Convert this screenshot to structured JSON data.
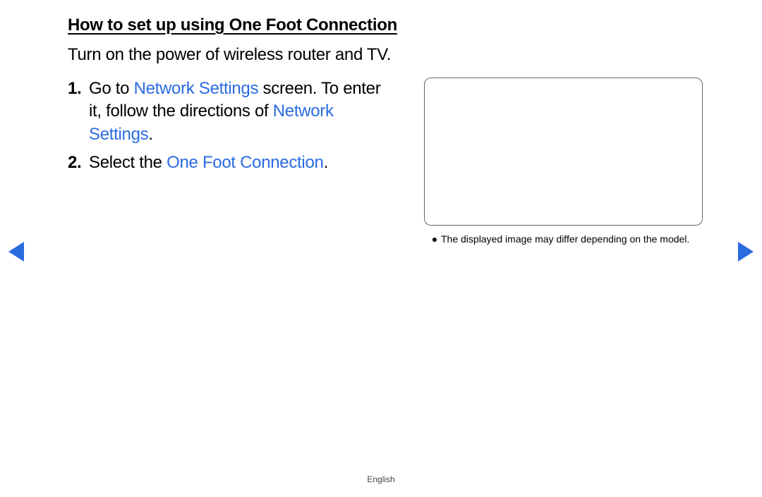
{
  "title": "How to set up using One Foot Connection",
  "intro": "Turn on the power of wireless router and TV.",
  "steps": [
    {
      "num": "1.",
      "parts": [
        {
          "t": "Go to ",
          "hl": false,
          "bold": false
        },
        {
          "t": "Network Settings",
          "hl": true,
          "bold": false
        },
        {
          "t": " screen. To enter it, follow the directions of ",
          "hl": false,
          "bold": false
        },
        {
          "t": "Network Settings",
          "hl": true,
          "bold": false
        },
        {
          "t": ".",
          "hl": false,
          "bold": false
        }
      ]
    },
    {
      "num": "2.",
      "parts": [
        {
          "t": "Select the ",
          "hl": false,
          "bold": false
        },
        {
          "t": "One Foot Connection",
          "hl": true,
          "bold": false
        },
        {
          "t": ".",
          "hl": false,
          "bold": false
        }
      ]
    }
  ],
  "caption_bullet": "●",
  "caption": "The displayed image may differ depending on the model.",
  "footer": "English"
}
